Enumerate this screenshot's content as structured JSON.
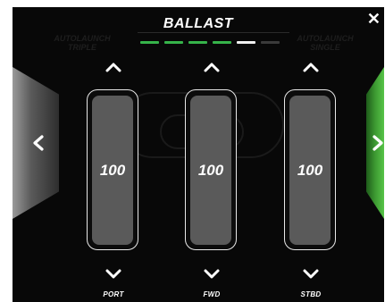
{
  "header": {
    "title": "BALLAST"
  },
  "progress": {
    "segments": [
      "green",
      "green",
      "green",
      "green",
      "white",
      "dark"
    ]
  },
  "background_labels": {
    "left": "AUTOLAUNCH\nTRIPLE",
    "right": "AUTOLAUNCH\nSINGLE"
  },
  "tanks": [
    {
      "label": "PORT",
      "value": "100",
      "fill_fraction": 1.0
    },
    {
      "label": "FWD",
      "value": "100",
      "fill_fraction": 1.0
    },
    {
      "label": "STBD",
      "value": "100",
      "fill_fraction": 1.0
    }
  ],
  "colors": {
    "accent_green": "#36b34a",
    "tank_fill": "#5a5a5a",
    "background": "#080808"
  },
  "icons": {
    "close": "close-icon",
    "prev": "chevron-left-icon",
    "next": "chevron-right-icon",
    "up": "chevron-up-icon",
    "down": "chevron-down-icon"
  }
}
